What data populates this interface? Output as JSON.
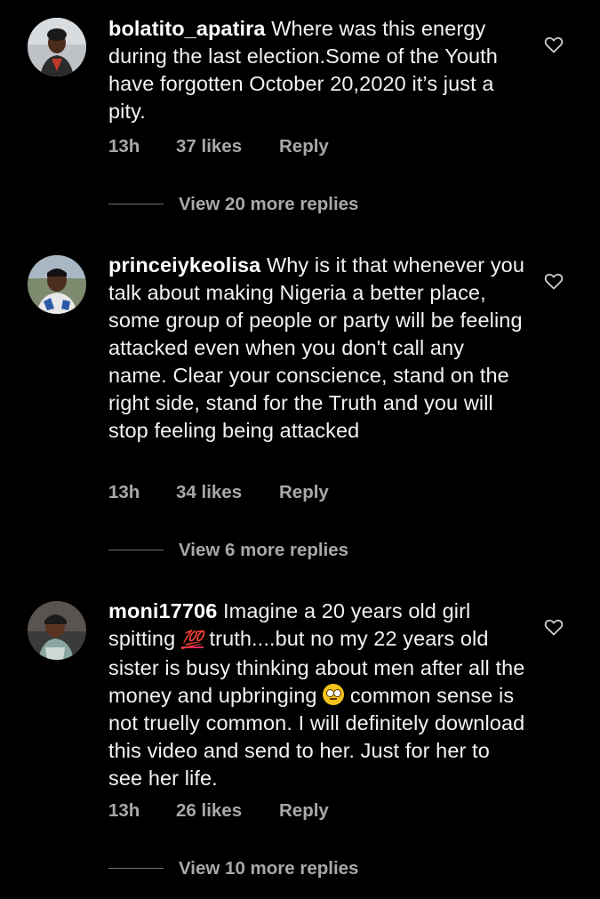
{
  "comments": [
    {
      "username": "bolatito_apatira",
      "text": " Where was this energy during the last election.Some of the Youth have forgotten October 20,2020 it’s just a pity.",
      "time": "13h",
      "likes": "37 likes",
      "reply_label": "Reply",
      "view_replies": "View 20 more replies"
    },
    {
      "username": "princeiykeolisa",
      "text": " Why is it that whenever you talk about making Nigeria a better place, some group of people or party will be feeling attacked even when you don't call any name. Clear your conscience, stand on the right side, stand for the Truth and you will stop feeling being attacked",
      "time": "13h",
      "likes": "34 likes",
      "reply_label": "Reply",
      "view_replies": "View 6 more replies"
    },
    {
      "username": "moni17706",
      "text_before_emoji": " Imagine a 20 years old girl spitting ",
      "emoji_1": "💯",
      "text_middle": " truth....but no my 22 years old sister is busy thinking about men after all the money and upbringing ",
      "emoji_2_name": "face-with-rolling-eyes",
      "text_after_emoji": " common sense is not truelly common. I will definitely download this video and send to her. Just for her to see her life.",
      "time": "13h",
      "likes": "26 likes",
      "reply_label": "Reply",
      "view_replies": "View 10 more replies"
    }
  ],
  "icons": {
    "like": "heart-outline-icon"
  },
  "colors": {
    "background": "#000000",
    "text": "#f2f2f2",
    "meta": "#a8a8a8"
  }
}
